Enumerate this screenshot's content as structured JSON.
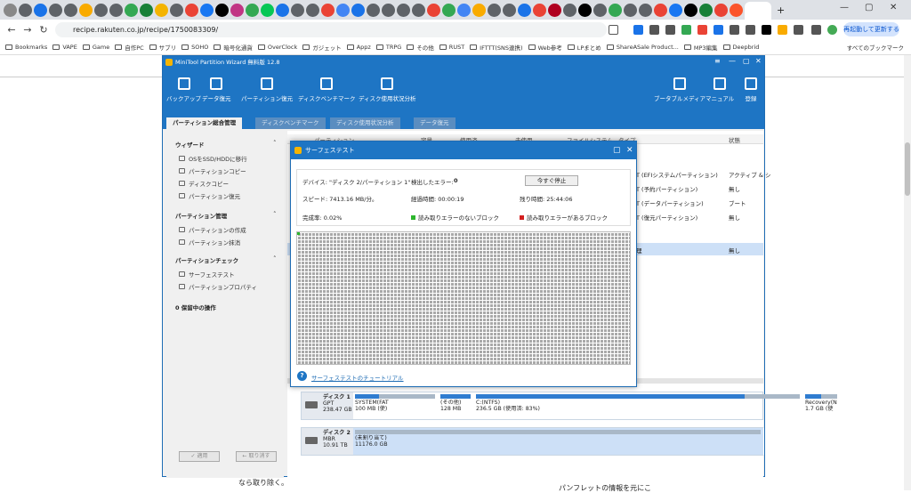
{
  "browser": {
    "url": "recipe.rakuten.co.jp/recipe/1750083309/",
    "relaunch_label": "再起動して更新する",
    "bookmarks": [
      "Bookmarks",
      "VAPE",
      "Game",
      "自作PC",
      "サブリ",
      "SOHO",
      "暗号化通貨",
      "OverClock",
      "ガジェット",
      "Appz",
      "TRPG",
      "その他",
      "RUST",
      "IFTTT(SNS連携)",
      "Web参考",
      "LPまとめ",
      "ShareASale Product...",
      "MP3編集",
      "Deepbrid"
    ],
    "all_bookmarks": "すべてのブックマーク",
    "tab_colors": [
      "#888",
      "#5f6368",
      "#1a73e8",
      "#5f6368",
      "#5f6368",
      "#f9ab00",
      "#5f6368",
      "#5f6368",
      "#34a853",
      "#188038",
      "#f4b400",
      "#5f6368",
      "#ea4335",
      "#1877f2",
      "#000000",
      "#c13584",
      "#34a853",
      "#06c755",
      "#1a73e8",
      "#5f6368",
      "#5f6368",
      "#ea4335",
      "#4285f4",
      "#1a73e8",
      "#5f6368",
      "#5f6368",
      "#5f6368",
      "#5f6368",
      "#ea4335",
      "#34a853",
      "#4285f4",
      "#f9ab00",
      "#5f6368",
      "#5f6368",
      "#1a73e8",
      "#ea4335",
      "#b00020",
      "#5f6368",
      "#000",
      "#5f6368",
      "#34a853",
      "#5f6368",
      "#5f6368",
      "#ea4335",
      "#1877f2",
      "#000",
      "#188038",
      "#ea4335",
      "#fb542b"
    ]
  },
  "app": {
    "title": "MiniTool Partition Wizard 無料版 12.8",
    "toolbar": [
      "バックアップ",
      "データ復元",
      "パーティション復元",
      "ディスクベンチマーク",
      "ディスク使用状況分析"
    ],
    "toolbar_right": [
      "ブータブルメディア",
      "マニュアル",
      "登録"
    ],
    "tabs": [
      "パーティション総合管理",
      "ディスクベンチマーク",
      "ディスク使用状況分析",
      "データ復元"
    ],
    "sidebar": {
      "wizard": "ウィザード",
      "wizard_items": [
        "OSをSSD/HDDに移行",
        "パーティションコピー",
        "ディスクコピー",
        "パーティション復元"
      ],
      "pm": "パーティション管理",
      "pm_items": [
        "パーティションの作成",
        "パーティション抹消"
      ],
      "check": "パーティションチェック",
      "check_items": [
        "サーフェステスト",
        "パーティションプロパティ"
      ],
      "pending": "0 保留中の操作"
    },
    "apply": "✓ 適用",
    "undo": "← 取り消す",
    "table": {
      "headers": [
        "パーティション",
        "容量",
        "使用済",
        "未使用",
        "ファイルシステム",
        "タイプ",
        "状態"
      ],
      "types": [
        "T (EFIシステムパーティション)",
        "T (予約パーティション)",
        "T (データパーティション)",
        "T (復元パーティション)",
        "理"
      ],
      "status": [
        "アクティブ & シ",
        "無し",
        "ブート",
        "無し",
        "無し"
      ]
    },
    "disks": [
      {
        "name": "ディスク 1",
        "type": "GPT",
        "size": "238.47 GB",
        "parts": [
          {
            "n": "SYSTEM(FAT",
            "s": "100 MB (使)",
            "fill": 0.3
          },
          {
            "n": "(その他)",
            "s": "128 MB",
            "fill": 1.0
          },
          {
            "n": "C:(NTFS)",
            "s": "236.5 GB (使用済: 83%)",
            "fill": 0.83
          },
          {
            "n": "Recovery(N",
            "s": "1.7 GB (使",
            "fill": 0.5
          }
        ]
      },
      {
        "name": "ディスク 2",
        "type": "MBR",
        "size": "10.91 TB",
        "parts": [
          {
            "n": "(未割り当て)",
            "s": "11176.0 GB",
            "fill": 1.0
          }
        ]
      }
    ]
  },
  "dialog": {
    "title": "サーフェステスト",
    "device": "デバイス: \"ディスク 2/パーティション 1\"",
    "errors_label": "検出したエラー:",
    "errors_value": "0",
    "stop": "今すぐ停止",
    "speed": "スピード: 7413.16 MB/分。",
    "elapsed": "経過時間:  00:00:19",
    "remaining": "残り時間:  25:44:06",
    "progress": "完成率:  0.02%",
    "legend_ok": "読み取りエラーのないブロック",
    "legend_err": "読み取りエラーがあるブロック",
    "help": "サーフェステストのチュートリアル"
  },
  "page_below": {
    "text1": "なら取り除く。",
    "text2": "パンフレットの情報を元にこ"
  }
}
